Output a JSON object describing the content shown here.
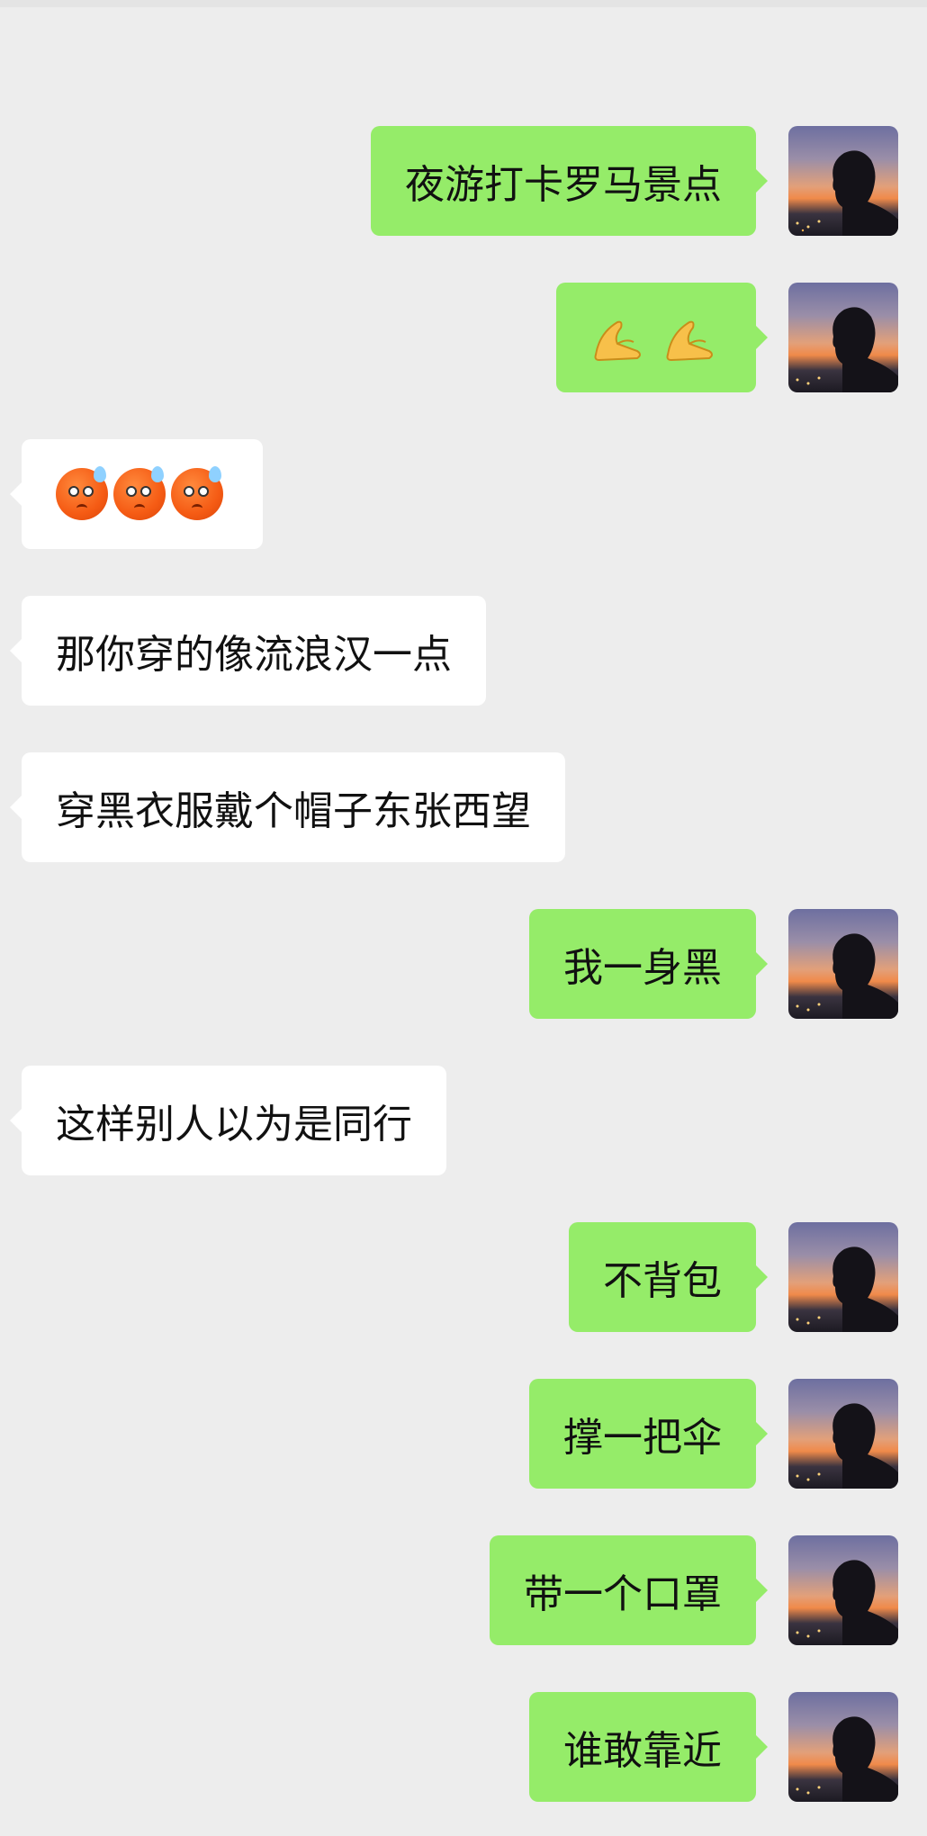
{
  "messages": [
    {
      "side": "right",
      "type": "text",
      "text": "夜游打卡罗马景点"
    },
    {
      "side": "right",
      "type": "emoji",
      "emoji": "🙏🙏",
      "icon": "pinched-hands-emoji"
    },
    {
      "side": "left",
      "type": "emoji",
      "emoji": "😰😰😰",
      "icon": "anxious-face-emoji"
    },
    {
      "side": "left",
      "type": "text",
      "text": "那你穿的像流浪汉一点"
    },
    {
      "side": "left",
      "type": "text",
      "text": "穿黑衣服戴个帽子东张西望"
    },
    {
      "side": "right",
      "type": "text",
      "text": "我一身黑"
    },
    {
      "side": "left",
      "type": "text",
      "text": "这样别人以为是同行"
    },
    {
      "side": "right",
      "type": "text",
      "text": "不背包"
    },
    {
      "side": "right",
      "type": "text",
      "text": "撑一把伞"
    },
    {
      "side": "right",
      "type": "text",
      "text": "带一个口罩"
    },
    {
      "side": "right",
      "type": "text",
      "text": "谁敢靠近"
    }
  ],
  "colors": {
    "background": "#ededed",
    "self_bubble": "#95ec69",
    "other_bubble": "#ffffff"
  }
}
